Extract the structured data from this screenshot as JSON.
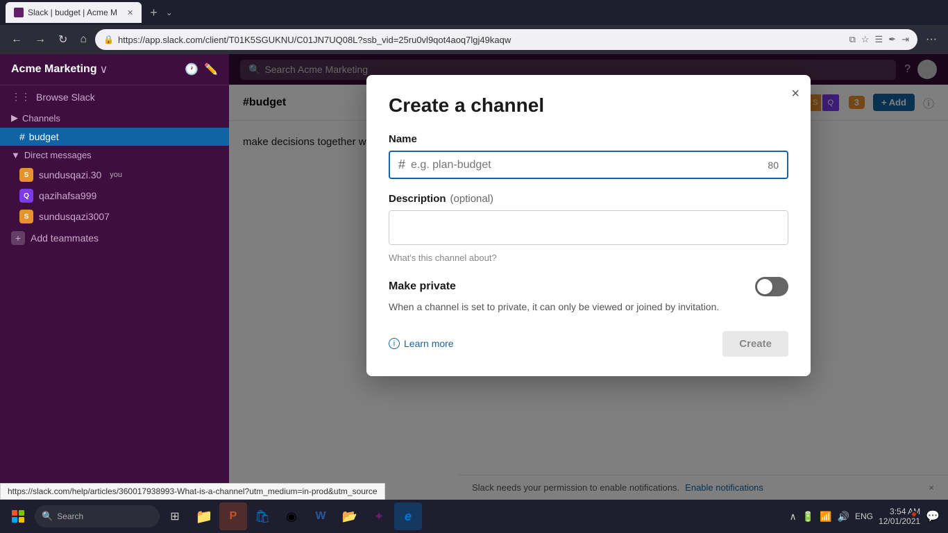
{
  "browser": {
    "tabs": [
      {
        "label": "Slack | budget | Acme M",
        "favicon": "slack",
        "active": true
      }
    ],
    "new_tab_label": "+",
    "url": "https://app.slack.com/client/T01K5SGUKNU/C01JN7UQ08L?ssb_vid=25ru0vl9qot4aoq7lgj49kaqw",
    "back_label": "←",
    "forward_label": "→",
    "refresh_label": "↻",
    "home_label": "⌂"
  },
  "sidebar": {
    "workspace_name": "Acme Marketing",
    "workspace_chevron": "∨",
    "search_placeholder": "Search Acme Marketing",
    "browse_slack_label": "Browse Slack",
    "channels_section": "Channels",
    "active_channel": "budget",
    "direct_messages_section": "Direct messages",
    "dm_items": [
      {
        "name": "sundusqazi.30",
        "badge": "you",
        "color": "#e8912d"
      },
      {
        "name": "qazihafsa999",
        "color": "#7c3aed"
      },
      {
        "name": "sundusqazi3007",
        "color": "#e8912d"
      }
    ],
    "add_teammates_label": "Add teammates"
  },
  "topbar": {
    "search_placeholder": "Search Acme Marketing",
    "help_icon": "?"
  },
  "channel_header": {
    "title": "#budget",
    "member_count": "3",
    "add_button_label": "+ Add",
    "info_icon": "ⓘ"
  },
  "channel_content": {
    "welcome_text": "make decisions together with your team."
  },
  "modal": {
    "title": "Create a channel",
    "close_label": "×",
    "name_label": "Name",
    "name_placeholder": "e.g. plan-budget",
    "name_hash": "#",
    "name_count": "80",
    "description_label": "Description",
    "description_optional": "(optional)",
    "description_placeholder": "",
    "description_hint": "What's this channel about?",
    "make_private_title": "Make private",
    "make_private_desc": "When a channel is set to private, it can only be viewed or joined by invitation.",
    "learn_more_label": "Learn more",
    "create_button_label": "Create"
  },
  "notification_bar": {
    "text": "Slack needs your permission to enable notifications.",
    "link_label": "Enable notifications",
    "close_label": "×"
  },
  "url_tooltip": {
    "text": "https://slack.com/help/articles/360017938993-What-is-a-channel?utm_medium=in-prod&utm_source"
  },
  "taskbar": {
    "search_placeholder": "Search",
    "time": "3:54 AM",
    "date": "12/01/2021",
    "lang": "ENG",
    "app_icons": [
      {
        "name": "task-view",
        "symbol": "⊞"
      },
      {
        "name": "file-explorer",
        "symbol": "📁"
      },
      {
        "name": "powerpoint",
        "symbol": "P"
      },
      {
        "name": "store",
        "symbol": "🛍"
      },
      {
        "name": "chrome",
        "symbol": "◉"
      },
      {
        "name": "word",
        "symbol": "W"
      },
      {
        "name": "files",
        "symbol": "📂"
      },
      {
        "name": "slack",
        "symbol": "✦"
      },
      {
        "name": "edge",
        "symbol": "e"
      }
    ]
  }
}
